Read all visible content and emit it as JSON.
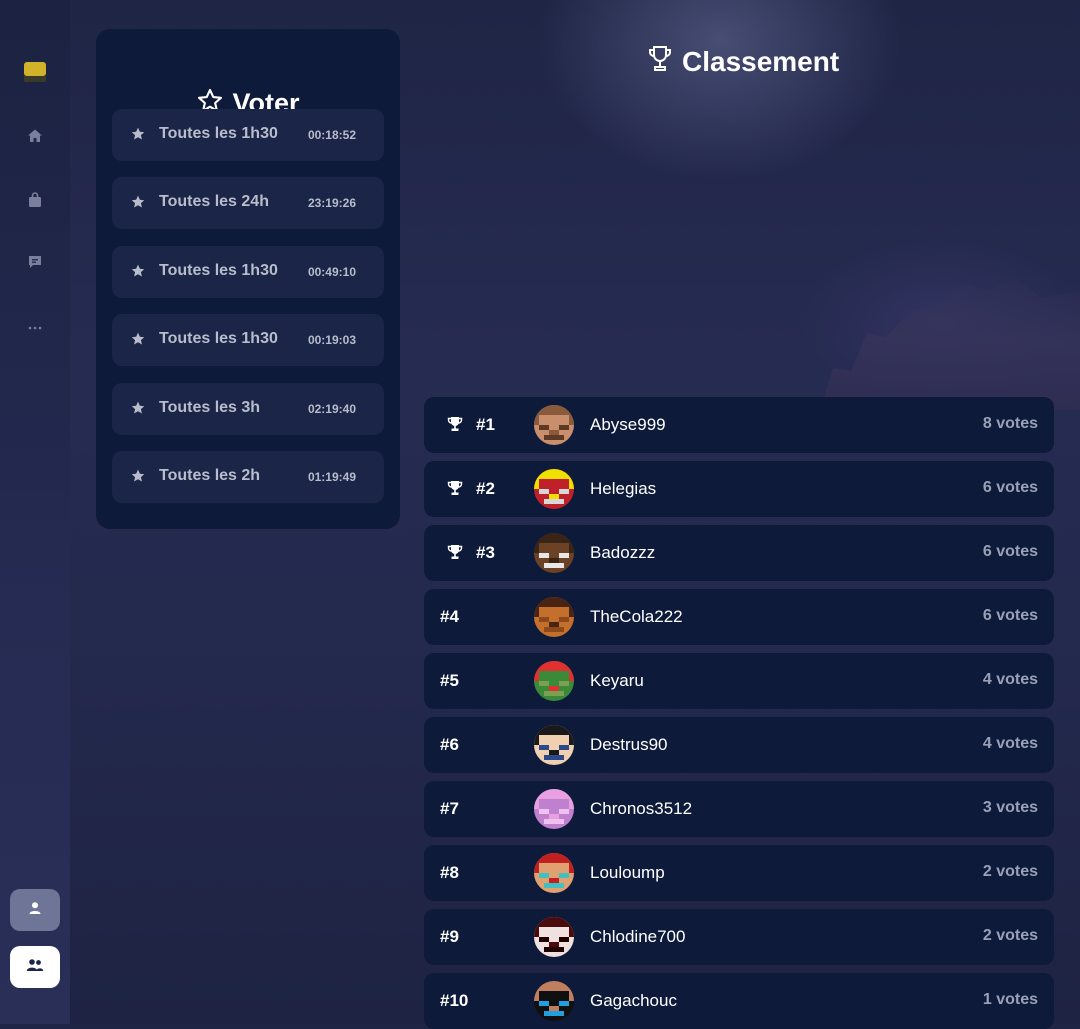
{
  "sidebar": {
    "icons": [
      "logo-icon",
      "home-icon",
      "shop-icon",
      "chat-icon",
      "more-icon"
    ],
    "profile_icon": "user-icon",
    "team_icon": "users-icon"
  },
  "vote": {
    "title": "Voter",
    "items": [
      {
        "label": "Toutes les 1h30",
        "timer": "00:18:52"
      },
      {
        "label": "Toutes les 24h",
        "timer": "23:19:26"
      },
      {
        "label": "Toutes les 1h30",
        "timer": "00:49:10"
      },
      {
        "label": "Toutes les 1h30",
        "timer": "00:19:03"
      },
      {
        "label": "Toutes les 3h",
        "timer": "02:19:40"
      },
      {
        "label": "Toutes les 2h",
        "timer": "01:19:49"
      }
    ]
  },
  "ranking": {
    "title": "Classement",
    "rows": [
      {
        "rank": "#1",
        "name": "Abyse999",
        "votes": "8 votes",
        "trophy": true,
        "avatar": [
          "#8a5a3c",
          "#c98f6c",
          "#5e3a25"
        ]
      },
      {
        "rank": "#2",
        "name": "Helegias",
        "votes": "6 votes",
        "trophy": true,
        "avatar": [
          "#f0e000",
          "#c0202a",
          "#d8d8d8"
        ]
      },
      {
        "rank": "#3",
        "name": "Badozzz",
        "votes": "6 votes",
        "trophy": true,
        "avatar": [
          "#3a2416",
          "#6b4226",
          "#e8e8e8"
        ]
      },
      {
        "rank": "#4",
        "name": "TheCola222",
        "votes": "6 votes",
        "trophy": false,
        "avatar": [
          "#4a2412",
          "#c4702c",
          "#8c4a1c"
        ]
      },
      {
        "rank": "#5",
        "name": "Keyaru",
        "votes": "4 votes",
        "trophy": false,
        "avatar": [
          "#e03030",
          "#3a8a3a",
          "#7aa050"
        ]
      },
      {
        "rank": "#6",
        "name": "Destrus90",
        "votes": "4 votes",
        "trophy": false,
        "avatar": [
          "#1a1a1a",
          "#f0d0b0",
          "#2a4a8a"
        ]
      },
      {
        "rank": "#7",
        "name": "Chronos3512",
        "votes": "3 votes",
        "trophy": false,
        "avatar": [
          "#e8a0e0",
          "#c080d0",
          "#f0c0f0"
        ]
      },
      {
        "rank": "#8",
        "name": "Louloump",
        "votes": "2 votes",
        "trophy": false,
        "avatar": [
          "#c02020",
          "#e0a070",
          "#40c0c0"
        ]
      },
      {
        "rank": "#9",
        "name": "Chlodine700",
        "votes": "2 votes",
        "trophy": false,
        "avatar": [
          "#4a0a0a",
          "#f0e0e0",
          "#200000"
        ]
      },
      {
        "rank": "#10",
        "name": "Gagachouc",
        "votes": "1 votes",
        "trophy": false,
        "avatar": [
          "#c08060",
          "#101010",
          "#20a0e0"
        ]
      }
    ]
  }
}
